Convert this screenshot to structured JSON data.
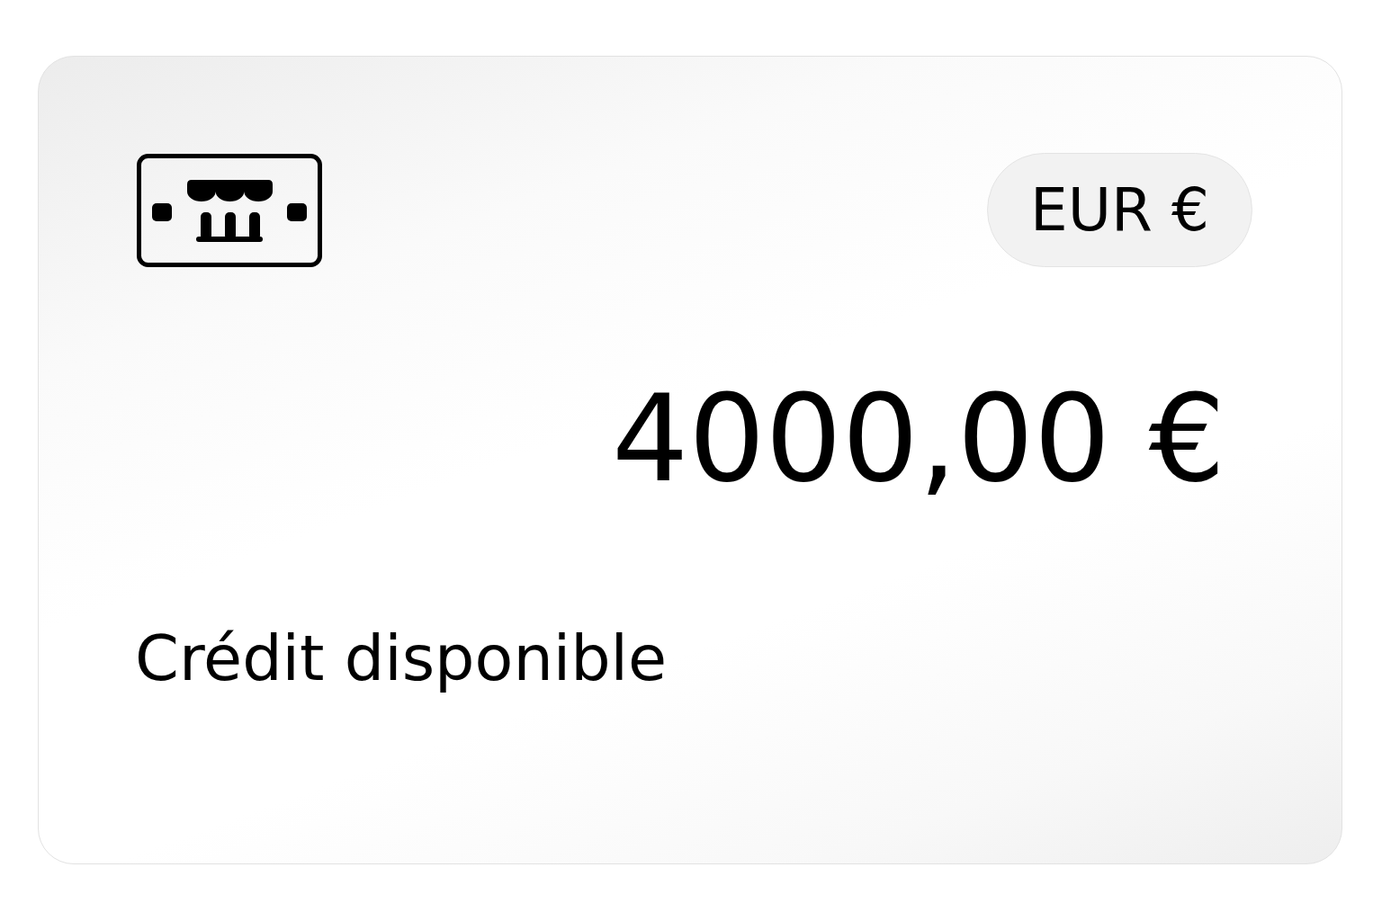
{
  "card": {
    "currency_badge": "EUR €",
    "amount": "4000,00 €",
    "label": "Crédit disponible"
  }
}
